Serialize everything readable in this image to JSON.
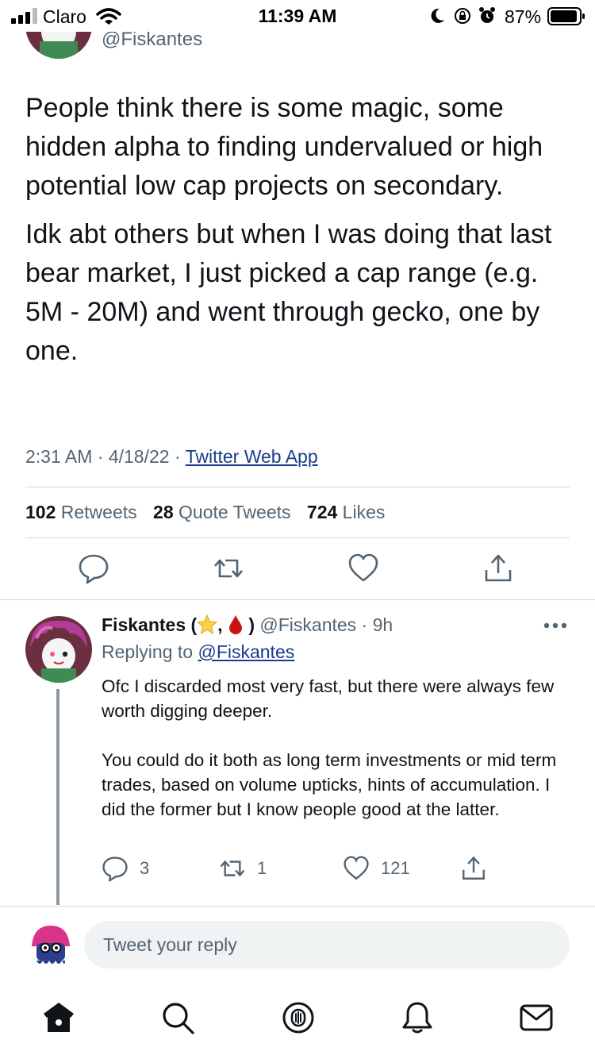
{
  "status_bar": {
    "carrier": "Claro",
    "time": "11:39 AM",
    "battery_percent": "87%"
  },
  "top": {
    "handle": "@Fiskantes"
  },
  "tweet": {
    "paragraphs": [
      "People think there is some magic, some hidden alpha to finding undervalued or high potential low cap projects on secondary.",
      "Idk abt others but when I was doing that last bear market, I just picked a cap range (e.g. 5M - 20M) and went through gecko, one by one."
    ],
    "timestamp": "2:31 AM · 4/18/22 · ",
    "source": "Twitter Web App",
    "retweets_count": "102",
    "retweets_label": "Retweets",
    "quotes_count": "28",
    "quotes_label": "Quote Tweets",
    "likes_count": "724",
    "likes_label": "Likes"
  },
  "reply": {
    "name": "Fiskantes (",
    "name_sep": ",",
    "name_end": ")",
    "handle_time": "@Fiskantes · 9h",
    "replying_prefix": "Replying to ",
    "replying_to": "@Fiskantes",
    "paragraphs": [
      "Ofc I discarded most very fast, but there were always few worth digging deeper.",
      "You could do it both as long term investments or mid term trades, based on volume upticks, hints of accumulation. I did the former but I know people good at the latter."
    ],
    "reply_count": "3",
    "retweet_count": "1",
    "like_count": "121"
  },
  "composer": {
    "placeholder": "Tweet your reply"
  },
  "nav": {
    "items": [
      "home-icon",
      "search-icon",
      "spaces-icon",
      "notifications-icon",
      "messages-icon"
    ]
  },
  "colors": {
    "text": "#0f1419",
    "secondary": "#536471",
    "link": "#1a3c8c",
    "divider": "#cfd9de"
  }
}
